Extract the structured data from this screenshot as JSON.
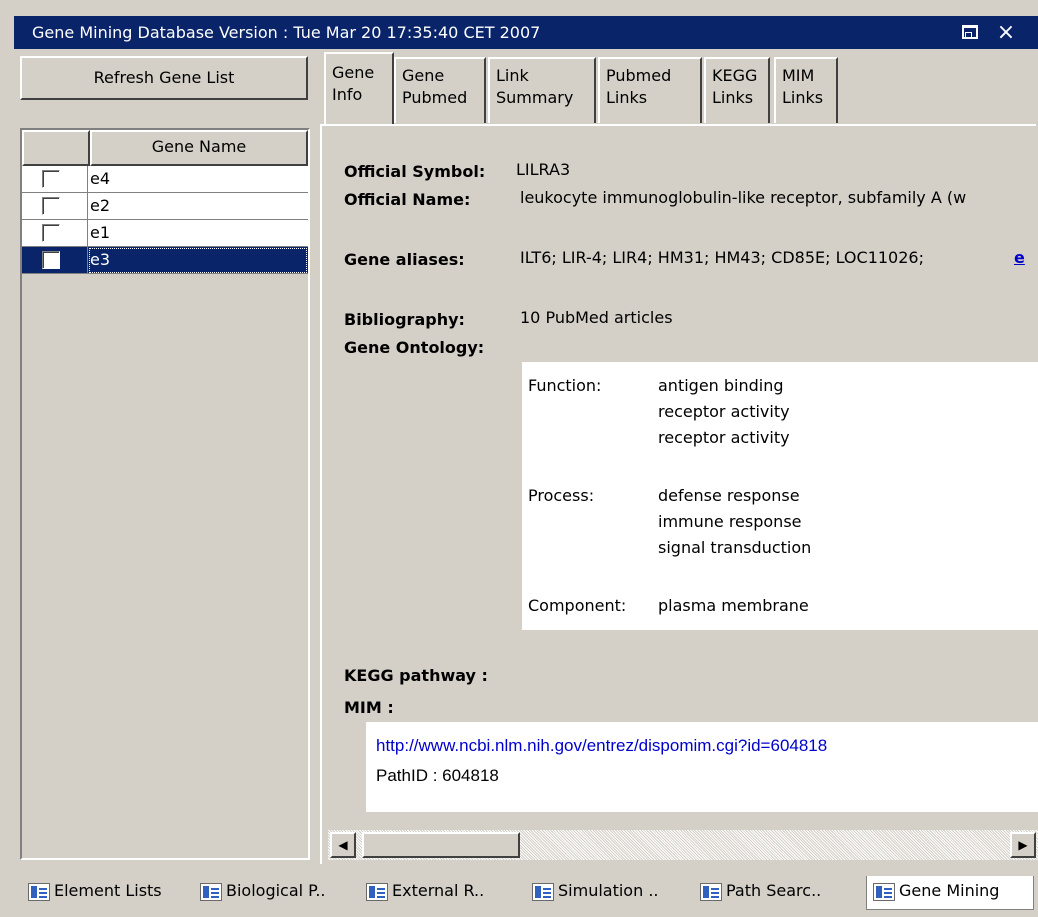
{
  "window": {
    "title": "Gene Mining Database Version : Tue Mar 20 17:35:40 CET 2007"
  },
  "left_panel": {
    "refresh_label": "Refresh Gene List",
    "table_header": "Gene Name",
    "genes": [
      {
        "name": "e4",
        "checked": false,
        "selected": false
      },
      {
        "name": "e2",
        "checked": false,
        "selected": false
      },
      {
        "name": "e1",
        "checked": false,
        "selected": false
      },
      {
        "name": "e3",
        "checked": false,
        "selected": true
      }
    ]
  },
  "tabs": [
    {
      "line1": "Gene",
      "line2": "Info",
      "active": true
    },
    {
      "line1": "Gene",
      "line2": "Pubmed",
      "active": false
    },
    {
      "line1": "Link",
      "line2": "Summary",
      "active": false
    },
    {
      "line1": "Pubmed",
      "line2": "Links",
      "active": false
    },
    {
      "line1": "KEGG",
      "line2": "Links",
      "active": false
    },
    {
      "line1": "MIM",
      "line2": "Links",
      "active": false
    }
  ],
  "gene_info": {
    "official_symbol_label": "Official Symbol:",
    "official_symbol": "LILRA3",
    "official_name_label": "Official Name:",
    "official_name": "leukocyte immunoglobulin-like receptor, subfamily A (w",
    "aliases_label": "Gene aliases:",
    "aliases": "ILT6; LIR-4; LIR4; HM31; HM43; CD85E; LOC11026;",
    "aliases_link": "e",
    "bibliography_label": "Bibliography:",
    "bibliography": "10 PubMed articles",
    "ontology_label": "Gene Ontology:",
    "ontology": {
      "function_label": "Function:",
      "function": [
        "antigen binding",
        "receptor activity",
        "receptor activity"
      ],
      "process_label": "Process:",
      "process": [
        "defense response",
        "immune response",
        "signal transduction"
      ],
      "component_label": "Component:",
      "component": [
        "plasma membrane"
      ]
    },
    "kegg_label": "KEGG pathway :",
    "mim_label": "MIM :",
    "mim_link": "http://www.ncbi.nlm.nih.gov/entrez/dispomim.cgi?id=604818",
    "mim_pathid": "PathID : 604818"
  },
  "bottom_tabs": [
    {
      "label": "Element Lists",
      "active": false
    },
    {
      "label": "Biological P..",
      "active": false
    },
    {
      "label": "External R..",
      "active": false
    },
    {
      "label": "Simulation ..",
      "active": false
    },
    {
      "label": "Path Searc..",
      "active": false
    },
    {
      "label": "Gene Mining",
      "active": true
    }
  ],
  "icons": {
    "restore": "restore-icon",
    "close": "close-icon",
    "tab": "view-list-icon"
  },
  "colors": {
    "titlebar": "#0a246a",
    "selection": "#0a246a",
    "link": "#0000cc",
    "window_bg": "#d4d0c8"
  }
}
